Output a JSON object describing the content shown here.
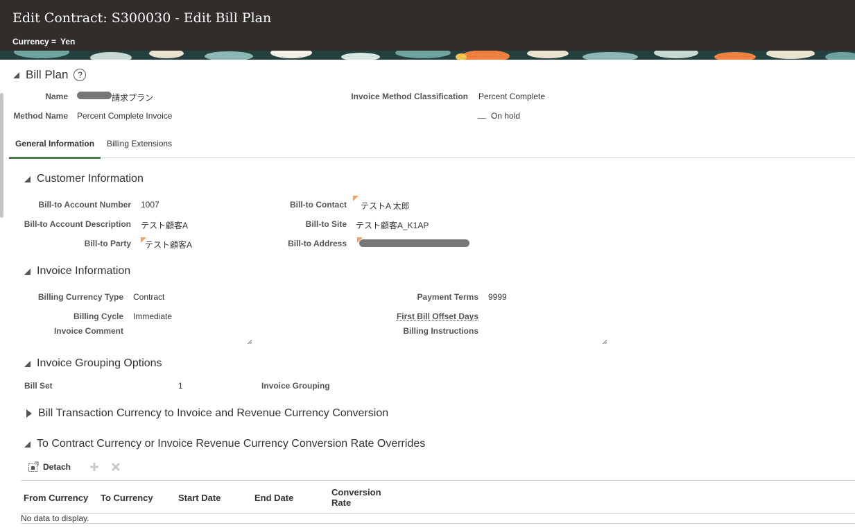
{
  "header": {
    "title": "Edit Contract: S300030 - Edit Bill Plan",
    "currency_label": "Currency =",
    "currency_value": "Yen"
  },
  "bill_plan": {
    "title": "Bill Plan",
    "help_icon": "?",
    "name_label": "Name",
    "name_value_suffix": "請求プラン",
    "method_label": "Method Name",
    "method_value": "Percent Complete Invoice",
    "inv_method_class_label": "Invoice Method Classification",
    "inv_method_class_value": "Percent Complete",
    "on_hold_label": "On hold"
  },
  "tabs": [
    {
      "label": "General Information",
      "active": true
    },
    {
      "label": "Billing Extensions",
      "active": false
    }
  ],
  "customer": {
    "title": "Customer Information",
    "acct_num_label": "Bill-to Account Number",
    "acct_num_value": "1007",
    "acct_desc_label": "Bill-to Account Description",
    "acct_desc_value": "テスト顧客A",
    "party_label": "Bill-to Party",
    "party_value": "テスト顧客A",
    "contact_label": "Bill-to Contact",
    "contact_value": "テストA 太郎",
    "site_label": "Bill-to Site",
    "site_value": "テスト顧客A_K1AP",
    "address_label": "Bill-to Address"
  },
  "invoice": {
    "title": "Invoice Information",
    "bct_label": "Billing Currency Type",
    "bct_value": "Contract",
    "cycle_label": "Billing Cycle",
    "cycle_value": "Immediate",
    "comment_label": "Invoice Comment",
    "terms_label": "Payment Terms",
    "terms_value": "9999",
    "offset_label": "First Bill Offset Days",
    "instructions_label": "Billing Instructions"
  },
  "grouping": {
    "title": "Invoice Grouping Options",
    "bill_set_label": "Bill Set",
    "bill_set_value": "1",
    "inv_grouping_label": "Invoice Grouping"
  },
  "conversion": {
    "title": "Bill Transaction Currency to Invoice and Revenue Currency Conversion"
  },
  "overrides": {
    "title": "To Contract Currency or Invoice Revenue Currency Conversion Rate Overrides",
    "detach_label": "Detach",
    "columns": [
      "From Currency",
      "To Currency",
      "Start Date",
      "End Date",
      "Conversion",
      "Rate"
    ],
    "no_data": "No data to display."
  },
  "colors": {
    "header_bg": "#312d2a",
    "tab_active": "#4a7a4a",
    "required_flag": "#f4a261"
  }
}
